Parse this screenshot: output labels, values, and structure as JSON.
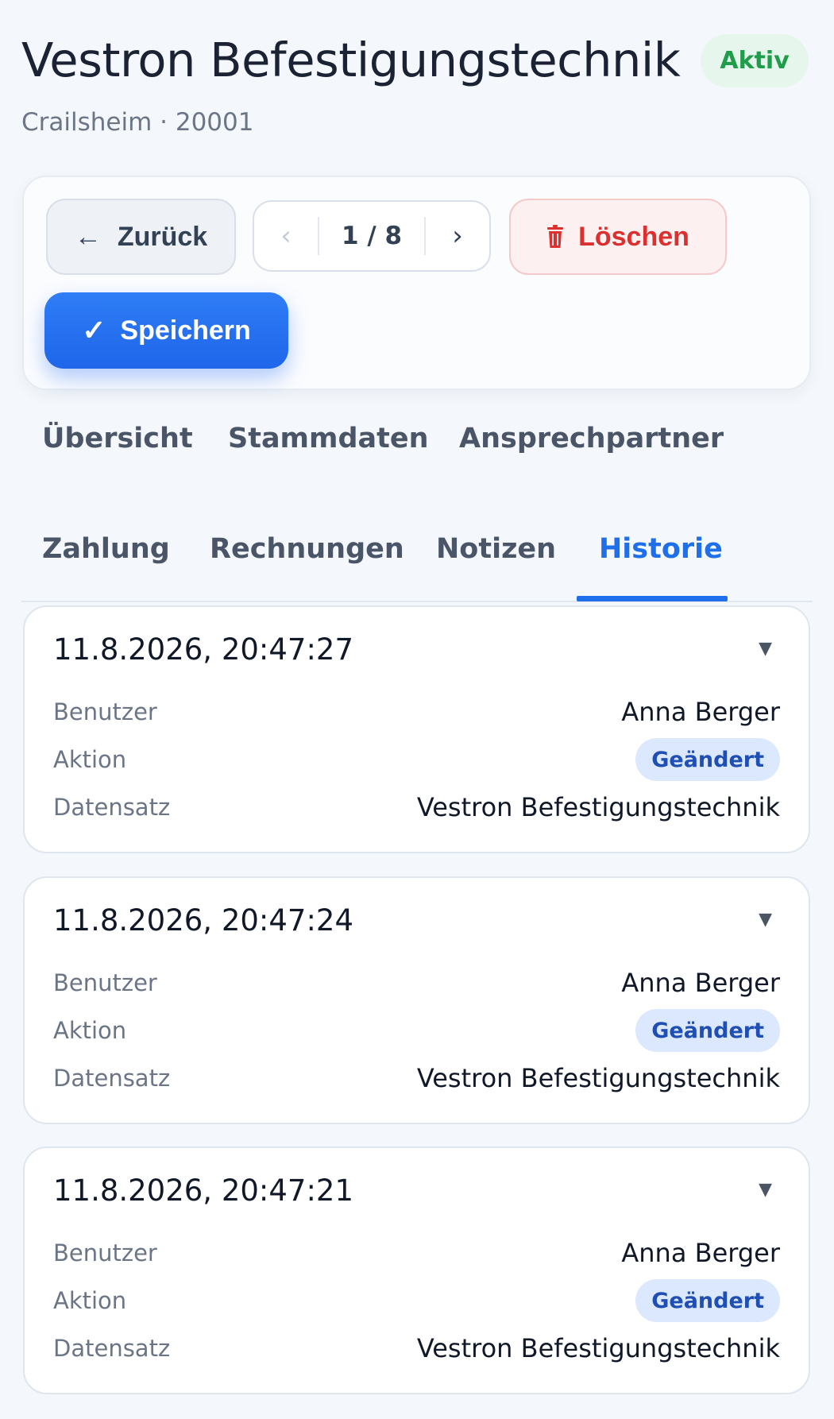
{
  "header": {
    "title": "Vestron Befestigungstechnik",
    "status": "Aktiv",
    "subtitle": "Crailsheim · 20001"
  },
  "toolbar": {
    "back_arrow": "←",
    "back_label": "Zurück",
    "pager": {
      "prev": "‹",
      "count": "1 / 8",
      "next": "›"
    },
    "delete_label": "Löschen",
    "save_check": "✓",
    "save_label": "Speichern"
  },
  "tabs": [
    {
      "label": "Übersicht",
      "active": false
    },
    {
      "label": "Stammdaten",
      "active": false
    },
    {
      "label": "Ansprechpartner",
      "active": false
    },
    {
      "label": "Zahlung",
      "active": false
    },
    {
      "label": "Rechnungen",
      "active": false
    },
    {
      "label": "Notizen",
      "active": false
    },
    {
      "label": "Historie",
      "active": true
    }
  ],
  "history": {
    "labels": {
      "user": "Benutzer",
      "action": "Aktion",
      "record": "Datensatz"
    },
    "toggle_symbol": "▼",
    "entries": [
      {
        "timestamp": "11.8.2026, 20:47:27",
        "user": "Anna Berger",
        "action": "Geändert",
        "record": "Vestron Befestigungstechnik"
      },
      {
        "timestamp": "11.8.2026, 20:47:24",
        "user": "Anna Berger",
        "action": "Geändert",
        "record": "Vestron Befestigungstechnik"
      },
      {
        "timestamp": "11.8.2026, 20:47:21",
        "user": "Anna Berger",
        "action": "Geändert",
        "record": "Vestron Befestigungstechnik"
      }
    ]
  },
  "colors": {
    "accent": "#1f6feb",
    "danger": "#dc2f2f",
    "success": "#1f9d4a",
    "badge_bg": "#dbe8fd"
  }
}
